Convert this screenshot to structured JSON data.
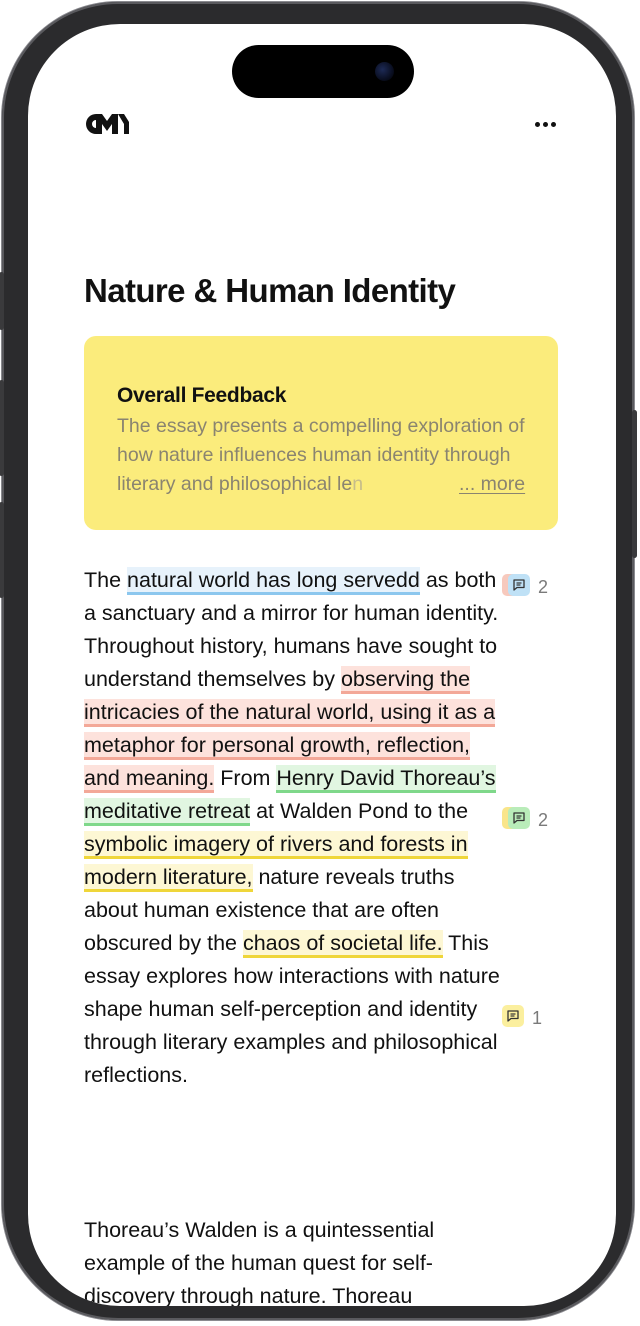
{
  "header": {
    "logo_text": "CM",
    "menu_icon": "more-horizontal-icon"
  },
  "page_title": "Nature & Human Identity",
  "feedback": {
    "heading": "Overall Feedback",
    "text_visible": "The essay presents a compelling exploration of how nature influences human identity through literary and philosophical le",
    "text_faded": "n",
    "more_label": "... more",
    "color": "#fbec7c"
  },
  "essay": {
    "p1": {
      "t1": "The ",
      "h1": "natural world has long servedd",
      "t2": " as both a sanctuary and a mirror for human identity. Throughout history, humans have sought to understand themselves by ",
      "h2": "observing the intricacies of the natural world, using it as a metaphor for personal growth, reflection, and meaning.",
      "t3": " From ",
      "h3": "Henry David Thoreau’s meditative retreat",
      "t4": " at Walden Pond to the ",
      "h4": "symbolic imagery of rivers and forests in modern literature,",
      "t5": " nature reveals truths about human existence that are often obscured by the ",
      "h5": "chaos of societal life.",
      "t6": " This essay explores how interactions with nature shape human self-perception and identity through literary examples and philosophical reflections."
    },
    "p2": "Thoreau’s Walden is a quintessential example of the human quest for self-discovery through nature. Thoreau"
  },
  "comments": [
    {
      "count": "2",
      "colors": [
        "#f7c9bd",
        "#bfe1f6"
      ],
      "icon": "comment-icon"
    },
    {
      "count": "2",
      "colors": [
        "#f9e58a",
        "#b9ecb9"
      ],
      "icon": "comment-icon"
    },
    {
      "count": "1",
      "colors": [
        "#fbef9e"
      ],
      "icon": "comment-icon"
    }
  ],
  "highlight_colors": {
    "blue": "#8cc7ee",
    "red": "#f3a898",
    "green": "#7fd88a",
    "yellow": "#efd63a"
  }
}
